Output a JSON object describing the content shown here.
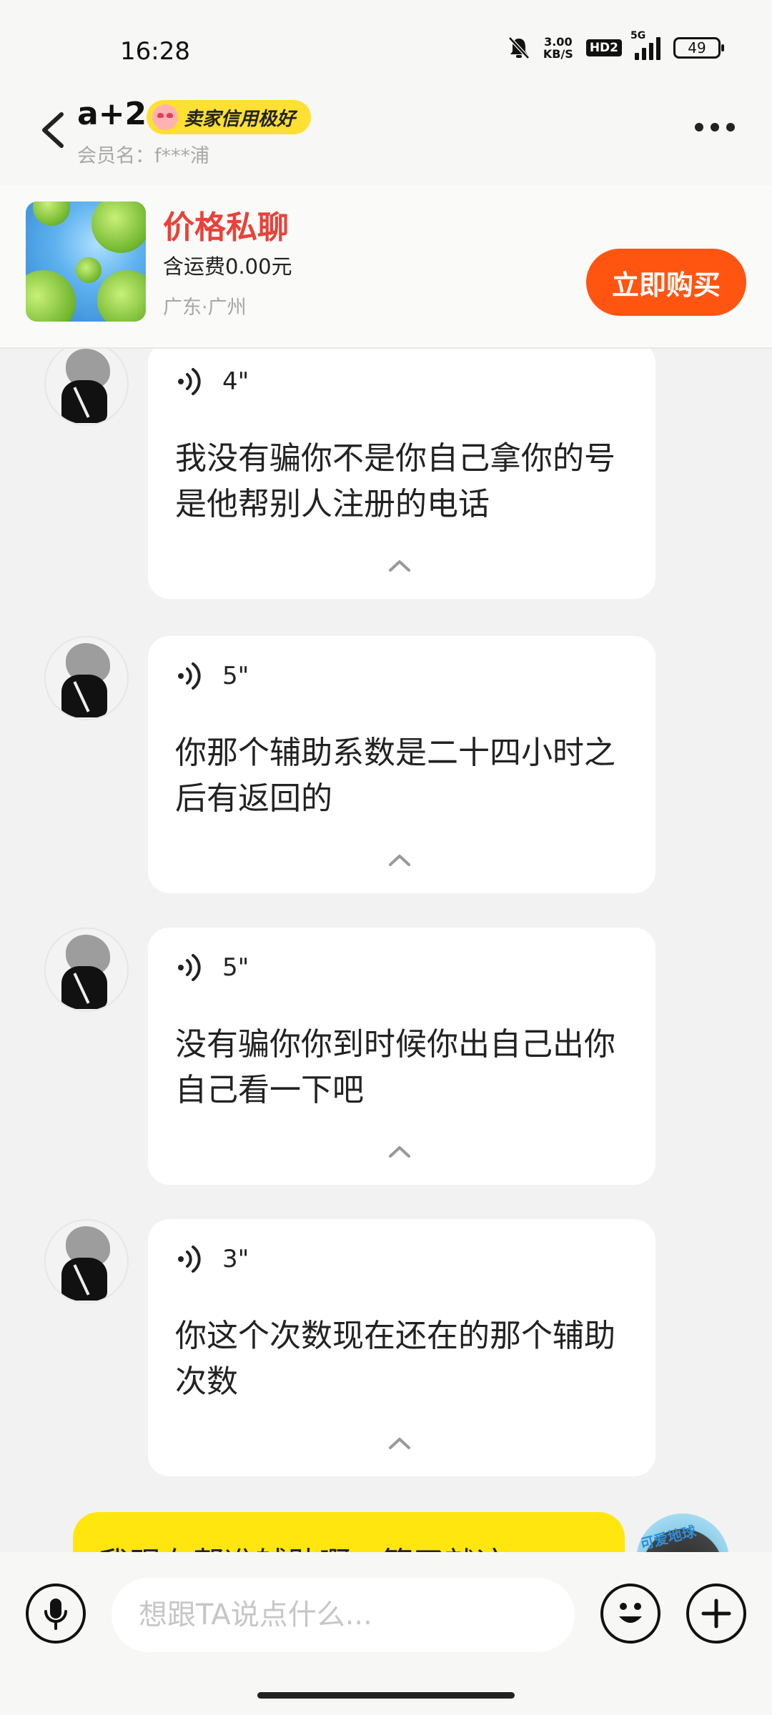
{
  "status_bar": {
    "time": "16:28",
    "net_speed_value": "3.00",
    "net_speed_unit": "KB/S",
    "hd_label": "HD2",
    "network_label": "5G",
    "battery": "49"
  },
  "header": {
    "title": "a+2",
    "credit_badge": "卖家信用极好",
    "member_name": "会员名：f***浦"
  },
  "product": {
    "price_label": "价格私聊",
    "shipping": "含运费0.00元",
    "location": "广东·广州",
    "buy_button": "立即购买"
  },
  "messages": [
    {
      "duration": "4\"",
      "text": "我没有骗你不是你自己拿你的号是他帮别人注册的电话"
    },
    {
      "duration": "5\"",
      "text": "你那个辅助系数是二十四小时之后有返回的"
    },
    {
      "duration": "5\"",
      "text": "没有骗你你到时候你出自己出你自己看一下吧"
    },
    {
      "duration": "3\"",
      "text": "你这个次数现在还在的那个辅助次数"
    }
  ],
  "outgoing_partial": {
    "text": "我现在帮准辅助啊，算了就这",
    "avatar_tag": "可爱地球"
  },
  "input_bar": {
    "placeholder": "想跟TA说点什么..."
  }
}
